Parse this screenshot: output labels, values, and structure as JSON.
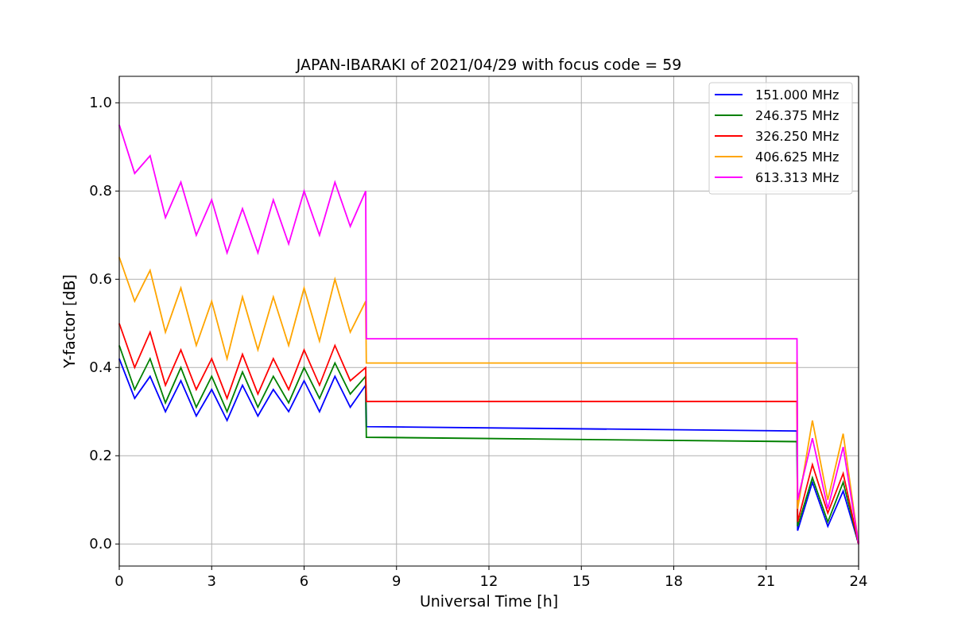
{
  "chart_data": {
    "type": "line",
    "title": "JAPAN-IBARAKI of 2021/04/29 with focus code = 59",
    "xlabel": "Universal Time [h]",
    "ylabel": "Y-factor [dB]",
    "x": [
      0,
      0.5,
      1,
      1.5,
      2,
      2.5,
      3,
      3.5,
      4,
      4.5,
      5,
      5.5,
      6,
      6.5,
      7,
      7.5,
      8,
      8.02,
      22,
      22.02,
      22.5,
      23,
      23.5,
      24
    ],
    "series": [
      {
        "name": "151.000 MHz",
        "color": "#0000ff",
        "values": [
          0.42,
          0.33,
          0.38,
          0.3,
          0.37,
          0.29,
          0.35,
          0.28,
          0.36,
          0.29,
          0.35,
          0.3,
          0.37,
          0.3,
          0.38,
          0.31,
          0.36,
          0.266,
          0.256,
          0.03,
          0.14,
          0.04,
          0.12,
          0.0
        ]
      },
      {
        "name": "246.375 MHz",
        "color": "#008000",
        "values": [
          0.45,
          0.35,
          0.42,
          0.32,
          0.4,
          0.31,
          0.38,
          0.3,
          0.39,
          0.31,
          0.38,
          0.32,
          0.4,
          0.33,
          0.41,
          0.34,
          0.38,
          0.242,
          0.232,
          0.04,
          0.15,
          0.05,
          0.14,
          0.0
        ]
      },
      {
        "name": "326.250 MHz",
        "color": "#ff0000",
        "values": [
          0.5,
          0.4,
          0.48,
          0.36,
          0.44,
          0.35,
          0.42,
          0.33,
          0.43,
          0.34,
          0.42,
          0.35,
          0.44,
          0.36,
          0.45,
          0.37,
          0.4,
          0.323,
          0.323,
          0.05,
          0.18,
          0.07,
          0.16,
          0.0
        ]
      },
      {
        "name": "406.625 MHz",
        "color": "#ffa500",
        "values": [
          0.65,
          0.55,
          0.62,
          0.48,
          0.58,
          0.45,
          0.55,
          0.42,
          0.56,
          0.44,
          0.56,
          0.45,
          0.58,
          0.46,
          0.6,
          0.48,
          0.55,
          0.41,
          0.41,
          0.08,
          0.28,
          0.1,
          0.25,
          0.0
        ]
      },
      {
        "name": "613.313 MHz",
        "color": "#ff00ff",
        "values": [
          0.95,
          0.84,
          0.88,
          0.74,
          0.82,
          0.7,
          0.78,
          0.66,
          0.76,
          0.66,
          0.78,
          0.68,
          0.8,
          0.7,
          0.82,
          0.72,
          0.8,
          0.465,
          0.465,
          0.1,
          0.24,
          0.08,
          0.22,
          0.0
        ]
      }
    ],
    "grid": true,
    "legend": true,
    "xlim": [
      0,
      24
    ],
    "ylim": [
      -0.05,
      1.06
    ],
    "xticks": [
      0,
      3,
      6,
      9,
      12,
      15,
      18,
      21,
      24
    ],
    "yticks": [
      {
        "value": 0,
        "label": "0.0"
      },
      {
        "value": 0.2,
        "label": "0.2"
      },
      {
        "value": 0.4,
        "label": "0.4"
      },
      {
        "value": 0.6,
        "label": "0.6"
      },
      {
        "value": 0.8,
        "label": "0.8"
      },
      {
        "value": 1.0,
        "label": "1.0"
      }
    ]
  }
}
